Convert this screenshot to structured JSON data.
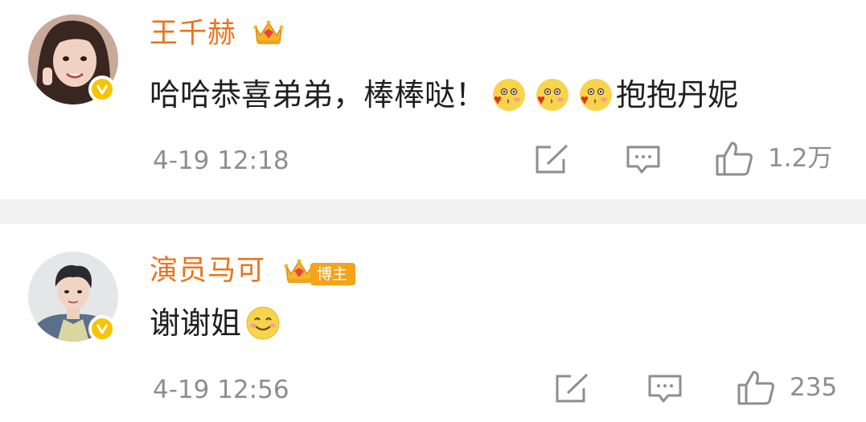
{
  "comments": [
    {
      "username": "王千赫",
      "text_before": "哈哈恭喜弟弟，棒棒哒！",
      "emoji": "kiss-emoji",
      "emoji_count": 3,
      "text_after": "抱抱丹妮",
      "timestamp": "4-19 12:18",
      "like_count": "1.2万",
      "avatar": "woman-avatar",
      "verified": true,
      "crown": "vip-crown-icon"
    },
    {
      "username": "演员马可",
      "author_tag": "博主",
      "text_before": "谢谢姐",
      "emoji": "smile-emoji",
      "emoji_count": 1,
      "timestamp": "4-19 12:56",
      "like_count": "235",
      "avatar": "man-avatar",
      "verified": true,
      "crown": "vip-crown-icon"
    }
  ],
  "colors": {
    "username": "#e8741f",
    "text": "#1f1f1f",
    "meta": "#8e8e8e",
    "separator": "#f2f2f2",
    "verified_badge": "#f7c400",
    "blogger_tag": "#f4a31b"
  }
}
